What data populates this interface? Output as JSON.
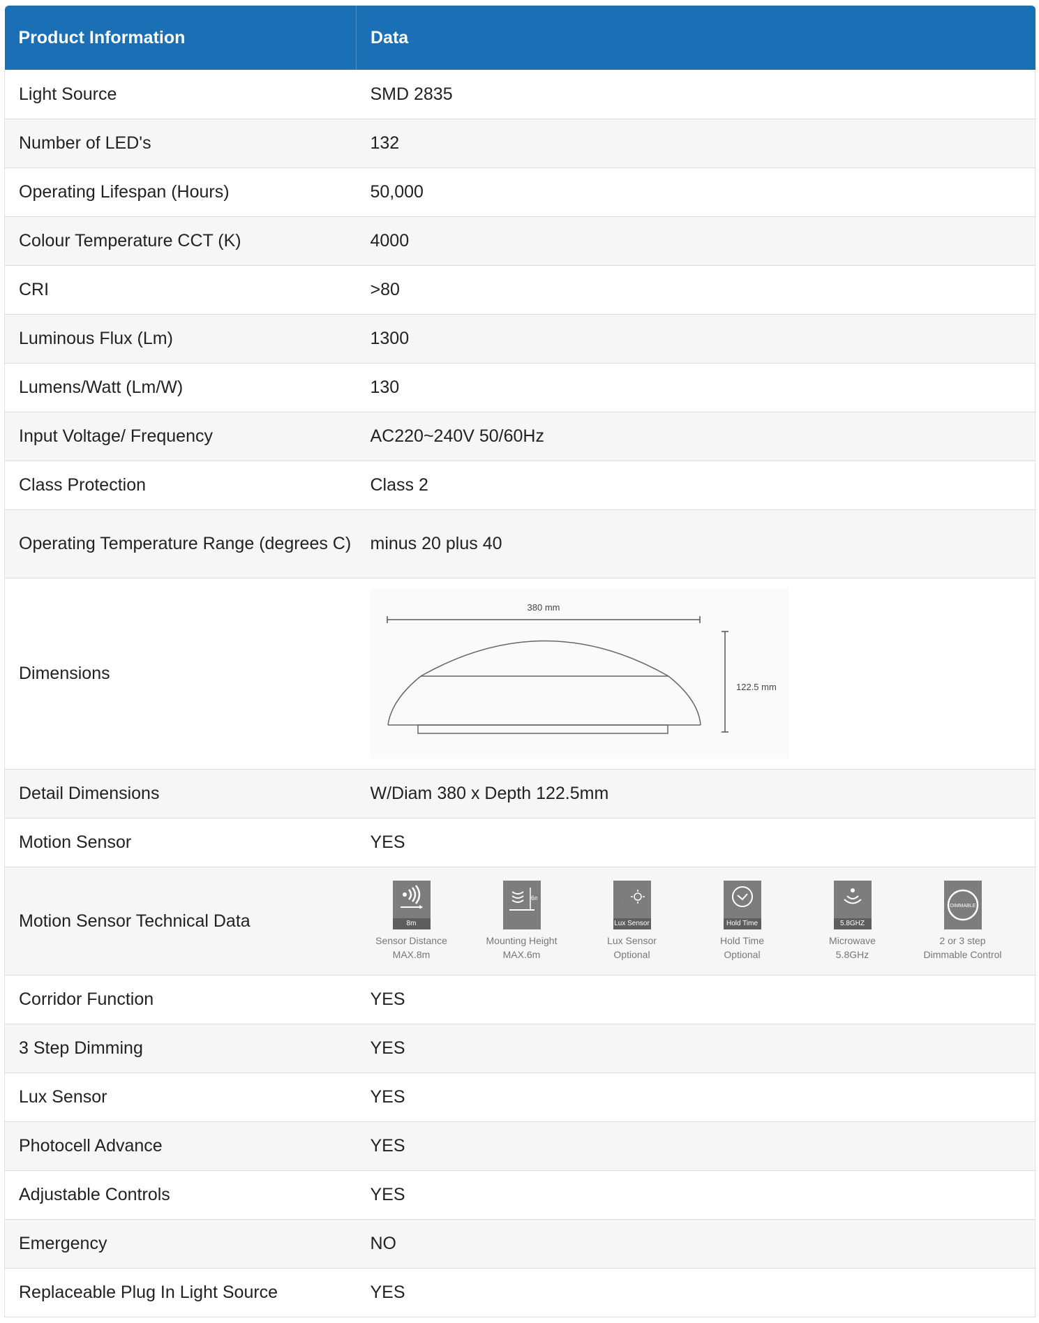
{
  "header": {
    "col1": "Product Information",
    "col2": "Data"
  },
  "rows": [
    {
      "label": "Light Source",
      "value": "SMD 2835"
    },
    {
      "label": "Number of LED's",
      "value": "132"
    },
    {
      "label": "Operating Lifespan (Hours)",
      "value": "50,000"
    },
    {
      "label": "Colour Temperature CCT (K)",
      "value": "4000"
    },
    {
      "label": "CRI",
      "value": ">80"
    },
    {
      "label": "Luminous Flux (Lm)",
      "value": "1300"
    },
    {
      "label": "Lumens/Watt (Lm/W)",
      "value": "130"
    },
    {
      "label": "Input Voltage/ Frequency",
      "value": "AC220~240V 50/60Hz"
    },
    {
      "label": "Class Protection",
      "value": "Class 2"
    },
    {
      "label": "Operating Temperature Range (degrees C)",
      "value": "minus 20 plus 40"
    },
    {
      "label": "Dimensions"
    },
    {
      "label": "Detail Dimensions",
      "value": "W/Diam 380 x Depth 122.5mm"
    },
    {
      "label": "Motion Sensor",
      "value": "YES"
    },
    {
      "label": "Motion Sensor Technical Data"
    },
    {
      "label": "Corridor Function",
      "value": "YES"
    },
    {
      "label": "3 Step Dimming",
      "value": "YES"
    },
    {
      "label": "Lux Sensor",
      "value": "YES"
    },
    {
      "label": "Photocell Advance",
      "value": "YES"
    },
    {
      "label": "Adjustable Controls",
      "value": "YES"
    },
    {
      "label": "Emergency",
      "value": "NO"
    },
    {
      "label": "Replaceable Plug In Light Source",
      "value": "YES"
    }
  ],
  "dimensions_drawing": {
    "width_label": "380 mm",
    "height_label": "122.5 mm"
  },
  "sensor_icons": [
    {
      "icon": "sensor-distance-icon",
      "tag": "8m",
      "cap1": "Sensor Distance",
      "cap2": "MAX.8m"
    },
    {
      "icon": "mounting-height-icon",
      "tag": "6m",
      "cap1": "Mounting Height",
      "cap2": "MAX.6m"
    },
    {
      "icon": "lux-sensor-icon",
      "tag": "Lux Sensor",
      "cap1": "Lux Sensor",
      "cap2": "Optional"
    },
    {
      "icon": "hold-time-icon",
      "tag": "Hold Time",
      "cap1": "Hold Time",
      "cap2": "Optional"
    },
    {
      "icon": "microwave-icon",
      "tag": "5.8GHZ",
      "cap1": "Microwave",
      "cap2": "5.8GHz"
    },
    {
      "icon": "dimmable-icon",
      "tag": "DIMMABLE",
      "cap1": "2 or 3 step",
      "cap2": "Dimmable Control"
    }
  ],
  "colors": {
    "header_bg": "#1a6fb5",
    "row_alt": "#f6f6f6",
    "icon_bg": "#7d7d7d"
  }
}
